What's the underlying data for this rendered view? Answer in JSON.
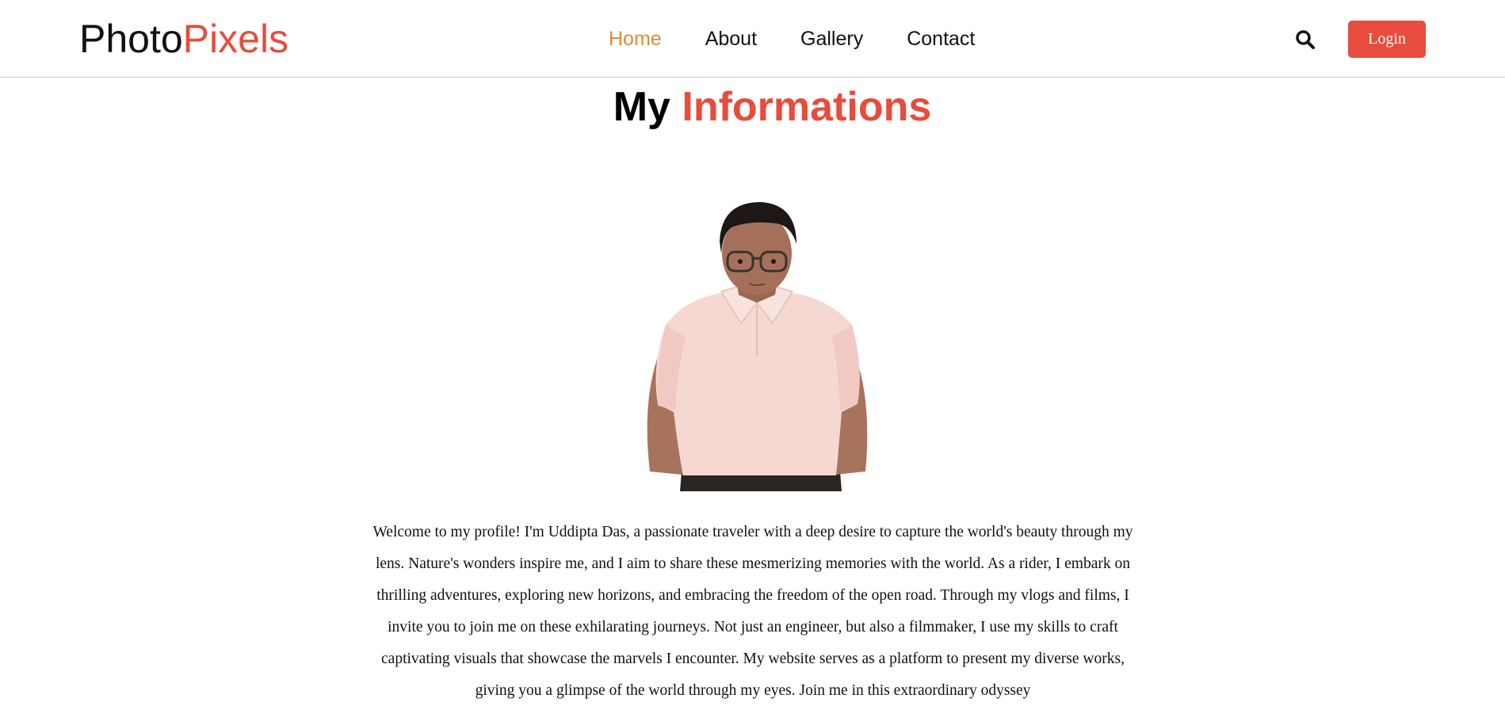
{
  "brand": {
    "name_part1": "Photo",
    "name_part2": "Pixels",
    "accent_color": "#e74c3c"
  },
  "nav": {
    "items": [
      {
        "label": "Home",
        "active": true
      },
      {
        "label": "About",
        "active": false
      },
      {
        "label": "Gallery",
        "active": false
      },
      {
        "label": "Contact",
        "active": false
      }
    ],
    "active_color": "#e38a37"
  },
  "header_actions": {
    "search_icon": "search-icon",
    "login_label": "Login",
    "login_color": "#e74c3c"
  },
  "main": {
    "title_part1": "My",
    "title_part2": "Informations",
    "photo_icon": "profile-photo",
    "bio": "Welcome to my profile! I'm Uddipta Das, a passionate traveler with a deep desire to capture the world's beauty through my lens. Nature's wonders inspire me, and I aim to share these mesmerizing memories with the world. As a rider, I embark on thrilling adventures, exploring new horizons, and embracing the freedom of the open road. Through my vlogs and films, I invite you to join me on these exhilarating journeys. Not just an engineer, but also a filmmaker, I use my skills to craft captivating visuals that showcase the marvels I encounter. My website serves as a platform to present my diverse works, giving you a glimpse of the world through my eyes. Join me in this extraordinary odyssey"
  }
}
